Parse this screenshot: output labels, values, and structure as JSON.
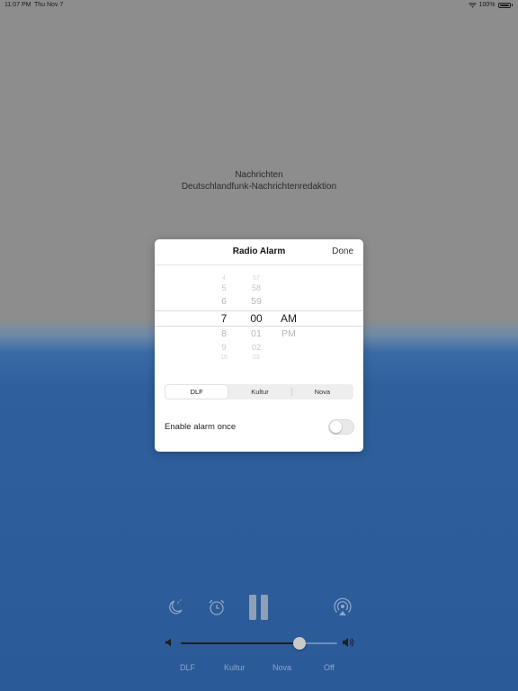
{
  "status_bar": {
    "time": "11:07 PM",
    "date": "Thu Nov 7",
    "battery": "100%"
  },
  "now_playing": {
    "title": "Nachrichten",
    "subtitle": "Deutschlandfunk-Nachrichtenredaktion"
  },
  "dialog": {
    "title": "Radio Alarm",
    "done_label": "Done",
    "picker": {
      "hours": [
        "4",
        "5",
        "6",
        "7",
        "8",
        "9",
        "10"
      ],
      "minutes": [
        "57",
        "58",
        "59",
        "00",
        "01",
        "02",
        "03"
      ],
      "ampm": [
        "AM",
        "PM"
      ],
      "selected": {
        "hour": "7",
        "minute": "00",
        "ampm": "AM"
      }
    },
    "stations": [
      "DLF",
      "Kultur",
      "Nova"
    ],
    "selected_station": "DLF",
    "toggle_label": "Enable alarm once",
    "toggle_on": false
  },
  "volume": {
    "level": 0.76
  },
  "station_bar": [
    "DLF",
    "Kultur",
    "Nova",
    "Off"
  ],
  "icons": [
    "wifi-icon",
    "battery-icon",
    "sleep-timer-icon",
    "alarm-clock-icon",
    "pause-icon",
    "airplay-icon",
    "volume-low-icon",
    "volume-high-icon"
  ],
  "colors": {
    "background_top": "#8d8d8d",
    "background_bottom": "#2a5a98",
    "station_label": "#8ea6c8"
  }
}
